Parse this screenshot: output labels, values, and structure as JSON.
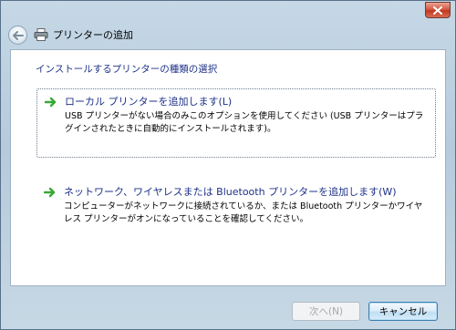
{
  "window": {
    "title": "プリンターの追加",
    "close_icon": "close-icon",
    "back_icon": "back-arrow-icon"
  },
  "content": {
    "heading": "インストールするプリンターの種類の選択",
    "options": [
      {
        "icon": "green-arrow-icon",
        "title": "ローカル プリンターを追加します(L)",
        "description": "USB プリンターがない場合のみこのオプションを使用してください (USB プリンターはプラグインされたときに自動的にインストールされます)。"
      },
      {
        "icon": "green-arrow-icon",
        "title": "ネットワーク、ワイヤレスまたは Bluetooth プリンターを追加します(W)",
        "description": "コンピューターがネットワークに接続されているか、または Bluetooth プリンターかワイヤレス プリンターがオンになっていることを確認してください。"
      }
    ]
  },
  "footer": {
    "next_label": "次へ(N)",
    "cancel_label": "キャンセル"
  },
  "colors": {
    "heading_blue": "#1e3287",
    "arrow_green": "#3aa835",
    "close_red": "#c0391f"
  }
}
